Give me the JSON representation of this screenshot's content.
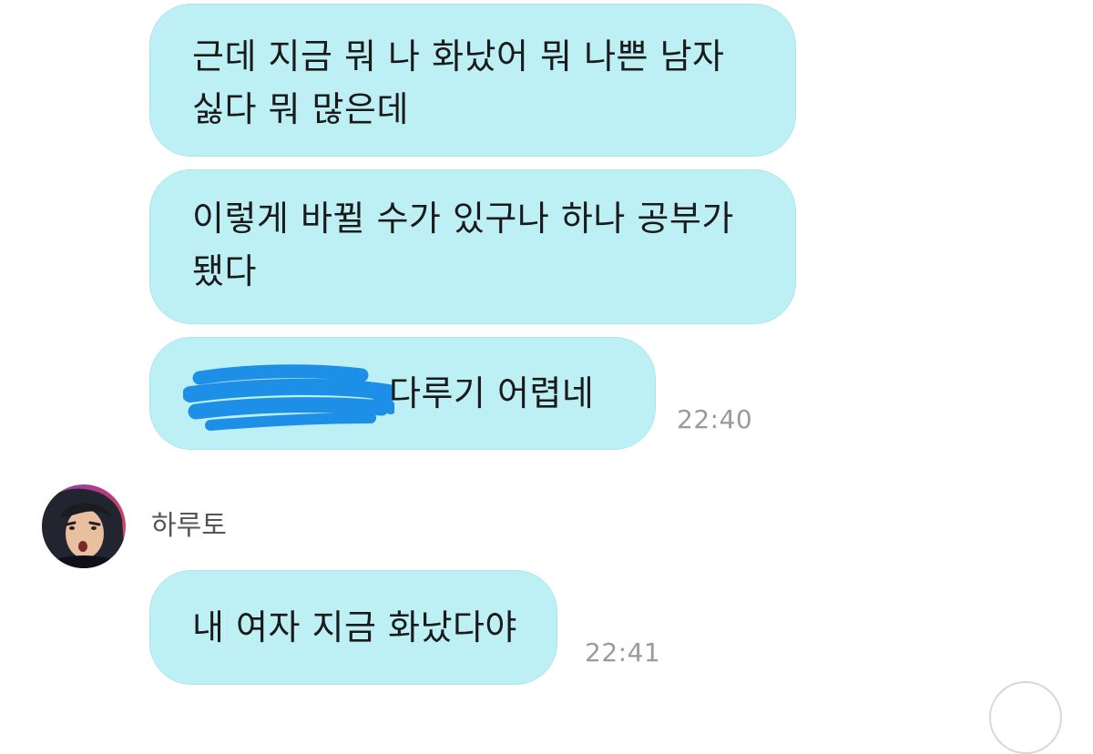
{
  "messages": [
    {
      "lines": [
        "근데 지금 뭐 나 화났어 뭐 나쁜 남자",
        "싫다 뭐 많은데"
      ]
    },
    {
      "lines": [
        "이렇게 바뀔 수가 있구나 하나 공부가",
        "됐다"
      ]
    },
    {
      "visible_text": "다루기 어렵네",
      "time": "22:40"
    },
    {
      "sender": "하루토",
      "text": "내 여자 지금 화났다야",
      "time": "22:41"
    }
  ],
  "colors": {
    "bubble": "#bdf0f4",
    "bubble_border": "#a9e6ec",
    "redaction": "#1e8fe6",
    "time_text": "#9a9a9a",
    "sender_text": "#555555"
  },
  "icons": {
    "avatar": "profile-avatar",
    "corner": "circle-button"
  }
}
